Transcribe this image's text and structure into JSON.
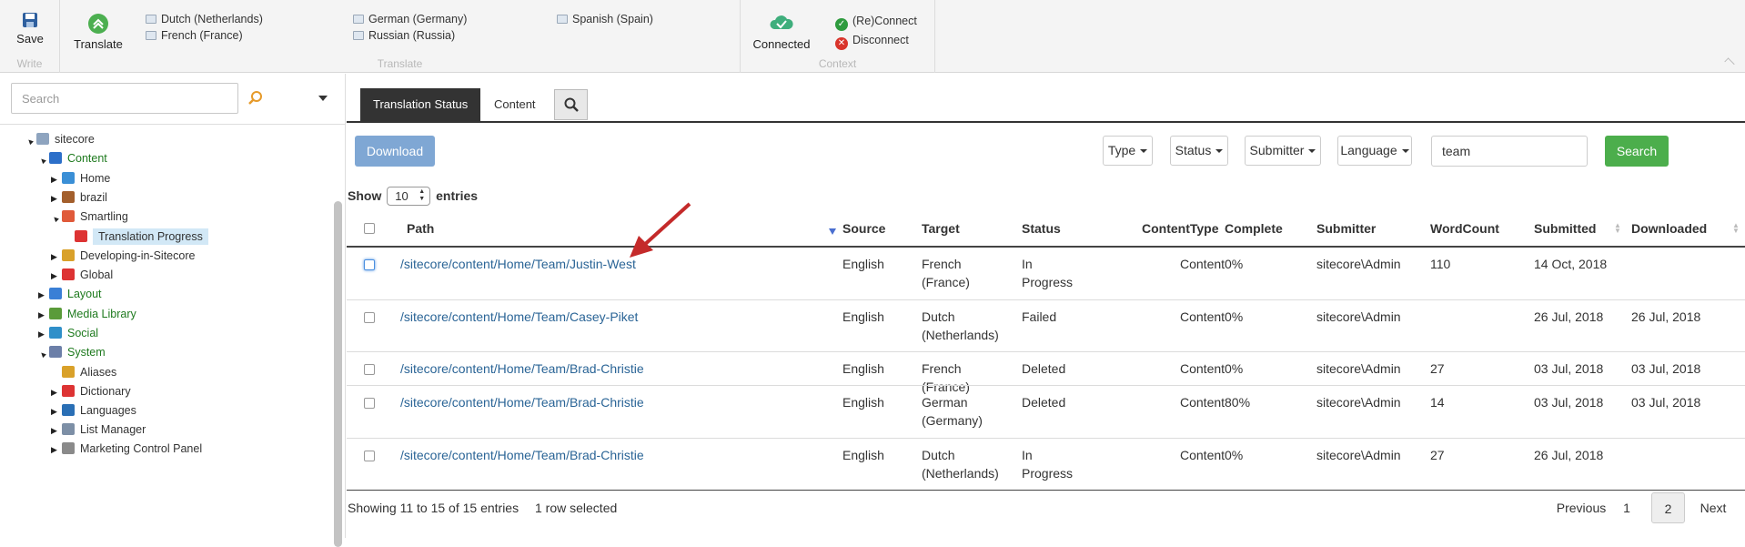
{
  "ribbon": {
    "write": {
      "save_label": "Save",
      "group_label": "Write"
    },
    "translate": {
      "translate_label": "Translate",
      "group_label": "Translate",
      "languages": [
        "Dutch (Netherlands)",
        "French (France)",
        "German (Germany)",
        "Russian (Russia)",
        "Spanish (Spain)"
      ]
    },
    "context": {
      "connected_label": "Connected",
      "reconnect_label": "(Re)Connect",
      "disconnect_label": "Disconnect",
      "group_label": "Context"
    }
  },
  "sidebar": {
    "search_placeholder": "Search",
    "tree": [
      {
        "label": "sitecore",
        "toggle": "▲",
        "icon": "document-icon",
        "color": "dark"
      },
      {
        "label": "Content",
        "toggle": "▲",
        "icon": "content-icon",
        "color": "green"
      },
      {
        "label": "Home",
        "toggle": "▶",
        "icon": "home-icon",
        "color": "dark"
      },
      {
        "label": "brazil",
        "toggle": "▶",
        "icon": "page-icon",
        "color": "dark"
      },
      {
        "label": "Smartling",
        "toggle": "▲",
        "icon": "smartling-icon",
        "color": "dark"
      },
      {
        "label": "Translation Progress",
        "toggle": "",
        "icon": "globe-icon",
        "color": "dark",
        "selected": true
      },
      {
        "label": "Developing-in-Sitecore",
        "toggle": "▶",
        "icon": "folder-icon",
        "color": "dark"
      },
      {
        "label": "Global",
        "toggle": "▶",
        "icon": "globe-icon",
        "color": "dark"
      },
      {
        "label": "Layout",
        "toggle": "▶",
        "icon": "layout-icon",
        "color": "green"
      },
      {
        "label": "Media Library",
        "toggle": "▶",
        "icon": "media-icon",
        "color": "green"
      },
      {
        "label": "Social",
        "toggle": "▶",
        "icon": "social-icon",
        "color": "green"
      },
      {
        "label": "System",
        "toggle": "▲",
        "icon": "system-icon",
        "color": "green"
      },
      {
        "label": "Aliases",
        "toggle": "",
        "icon": "folder-icon",
        "color": "dark"
      },
      {
        "label": "Dictionary",
        "toggle": "▶",
        "icon": "dictionary-icon",
        "color": "dark"
      },
      {
        "label": "Languages",
        "toggle": "▶",
        "icon": "languages-icon",
        "color": "dark"
      },
      {
        "label": "List Manager",
        "toggle": "▶",
        "icon": "list-icon",
        "color": "dark"
      },
      {
        "label": "Marketing Control Panel",
        "toggle": "▶",
        "icon": "marketing-icon",
        "color": "dark"
      }
    ]
  },
  "main": {
    "tabs": [
      "Translation Status",
      "Content"
    ],
    "download_label": "Download",
    "filters": [
      "Type",
      "Status",
      "Submitter",
      "Language"
    ],
    "search_value": "team",
    "search_label": "Search",
    "show_label": "Show",
    "entries_label": "entries",
    "page_size": "10",
    "columns": [
      "Path",
      "Source",
      "Target",
      "Status",
      "ContentType",
      "Complete",
      "Submitter",
      "WordCount",
      "Submitted",
      "Downloaded"
    ],
    "rows": [
      {
        "path": "/sitecore/content/Home/Team/Justin-West",
        "source": "English",
        "target": "French (France)",
        "status": "In Progress",
        "content_type": "Content",
        "complete": "0%",
        "submitter": "sitecore\\Admin",
        "word_count": "110",
        "submitted": "14 Oct, 2018",
        "downloaded": ""
      },
      {
        "path": "/sitecore/content/Home/Team/Casey-Piket",
        "source": "English",
        "target": "Dutch (Netherlands)",
        "status": "Failed",
        "content_type": "Content",
        "complete": "0%",
        "submitter": "sitecore\\Admin",
        "word_count": "",
        "submitted": "26 Jul, 2018",
        "downloaded": "26 Jul, 2018"
      },
      {
        "path": "/sitecore/content/Home/Team/Brad-Christie",
        "source": "English",
        "target": "French (France)",
        "status": "Deleted",
        "content_type": "Content",
        "complete": "0%",
        "submitter": "sitecore\\Admin",
        "word_count": "27",
        "submitted": "03 Jul, 2018",
        "downloaded": "03 Jul, 2018"
      },
      {
        "path": "/sitecore/content/Home/Team/Brad-Christie",
        "source": "English",
        "target": "German (Germany)",
        "status": "Deleted",
        "content_type": "Content",
        "complete": "80%",
        "submitter": "sitecore\\Admin",
        "word_count": "14",
        "submitted": "03 Jul, 2018",
        "downloaded": "03 Jul, 2018"
      },
      {
        "path": "/sitecore/content/Home/Team/Brad-Christie",
        "source": "English",
        "target": "Dutch (Netherlands)",
        "status": "In Progress",
        "content_type": "Content",
        "complete": "0%",
        "submitter": "sitecore\\Admin",
        "word_count": "27",
        "submitted": "26 Jul, 2018",
        "downloaded": ""
      }
    ],
    "info": "Showing 11 to 15 of 15 entries",
    "selection_info": "1 row selected",
    "pagination": {
      "previous": "Previous",
      "pages": [
        "1",
        "2"
      ],
      "next": "Next"
    }
  },
  "colors": {
    "accent_green": "#4cae4c",
    "download_blue": "#7fa7d4",
    "link": "#2a6496",
    "tab_active": "#333333",
    "tree_green": "#1e7a1e",
    "arrow_red": "#c42a2a"
  }
}
